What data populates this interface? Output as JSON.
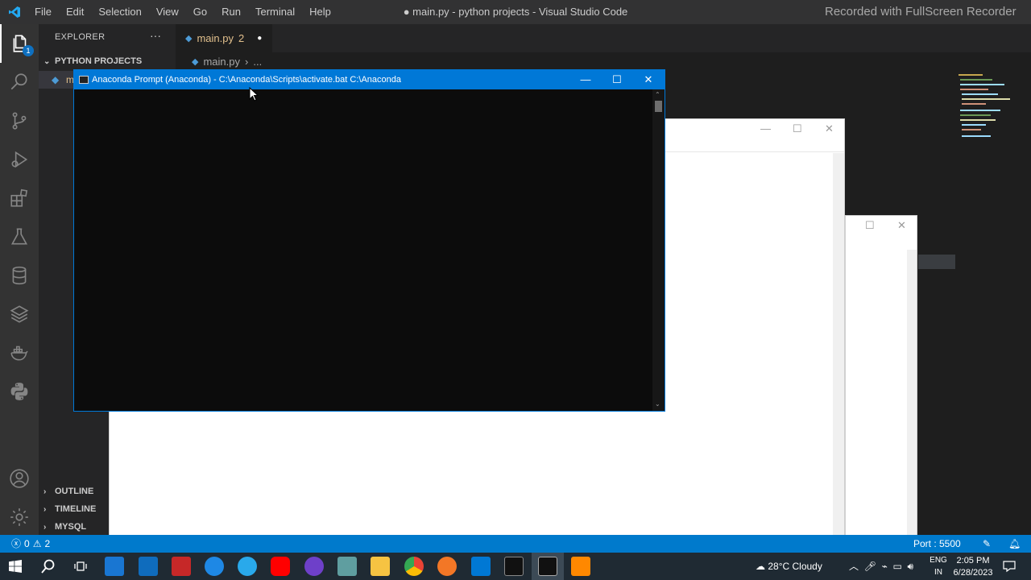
{
  "titlebar": {
    "menu": [
      "File",
      "Edit",
      "Selection",
      "View",
      "Go",
      "Run",
      "Terminal",
      "Help"
    ],
    "title": "● main.py - python projects - Visual Studio Code",
    "watermark": "Recorded with FullScreen Recorder"
  },
  "activitybar": {
    "explorer_badge": "1",
    "icons": [
      "files-icon",
      "search-icon",
      "source-control-icon",
      "run-debug-icon",
      "extensions-icon",
      "testing-icon",
      "database-icon",
      "layers-icon",
      "docker-icon",
      "python-icon",
      "account-icon",
      "settings-gear-icon"
    ]
  },
  "sidebar": {
    "header": "EXPLORER",
    "more": "···",
    "folder": "PYTHON PROJECTS",
    "file_partial": "m",
    "sections": [
      "OUTLINE",
      "TIMELINE",
      "MYSQL"
    ]
  },
  "editor": {
    "tab_label": "main.py",
    "tab_problems": "2",
    "breadcrumb_file": "main.py",
    "breadcrumb_more": "..."
  },
  "statusbar": {
    "errors": "0",
    "warnings": "2",
    "port": "Port : 5500"
  },
  "conda": {
    "title": "Anaconda Prompt (Anaconda) - C:\\Anaconda\\Scripts\\activate.bat  C:\\Anaconda"
  },
  "taskbar": {
    "weather": "28°C  Cloudy",
    "lang1": "ENG",
    "lang2": "IN",
    "time": "2:05 PM",
    "date": "6/28/2023"
  },
  "colors": {
    "accent": "#007acc",
    "conda_title": "#0078d7",
    "tab_modified": "#e2c08d"
  }
}
